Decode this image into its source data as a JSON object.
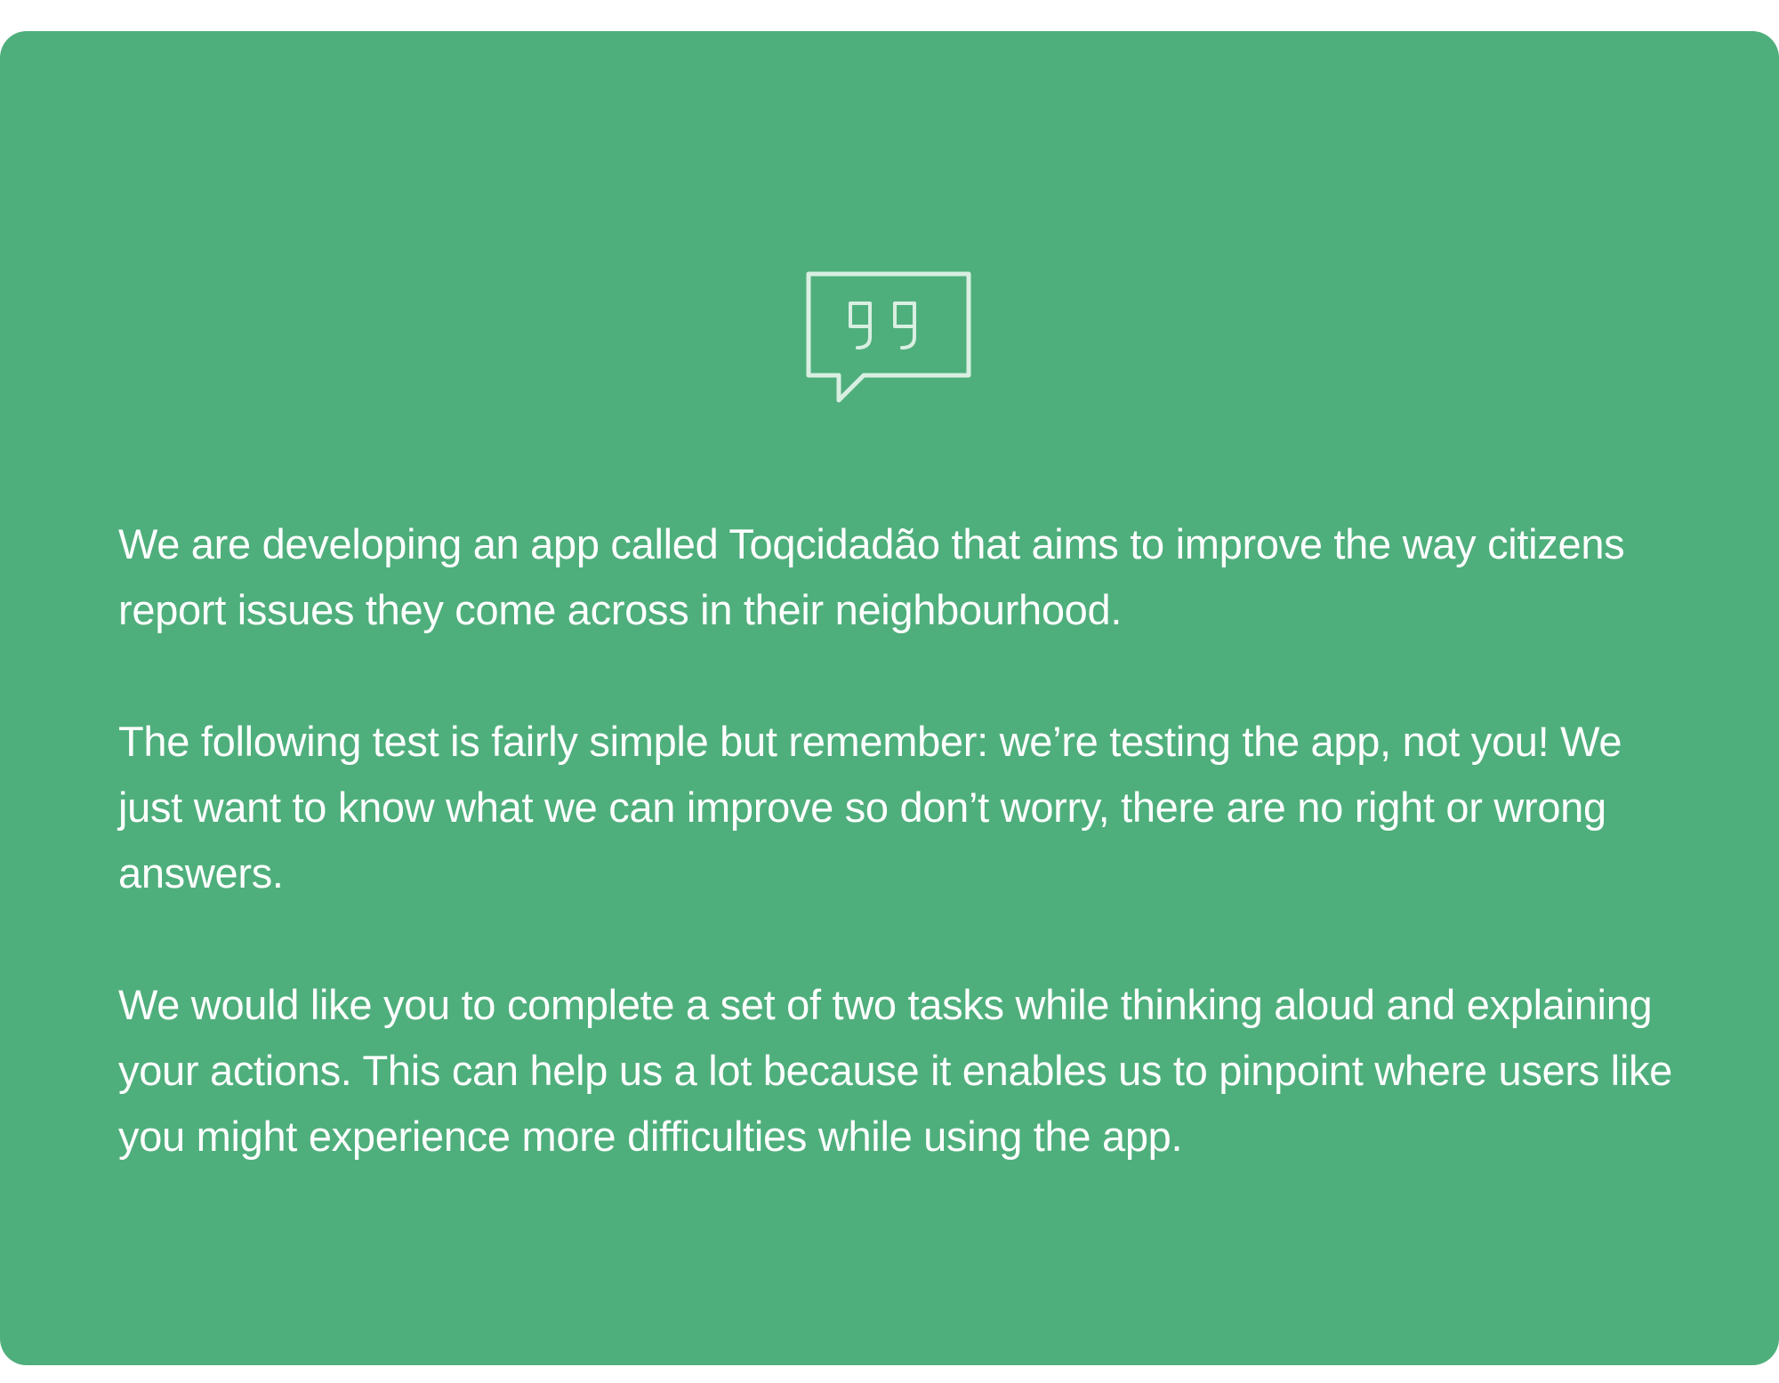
{
  "card": {
    "background_color": "#4faf7c",
    "text_color": "#ffffff",
    "icon": "quote-speech-bubble-icon",
    "paragraphs": [
      "We are developing an app called Toqcidadão that aims to improve the way citizens report issues they come across in their neighbourhood.",
      "The following test is fairly simple but remember: we’re testing the app, not you! We just want to know what we can improve so don’t worry, there are no right or wrong answers.",
      "We would like you to complete a set of two tasks while thinking aloud and explaining your actions. This can help us a lot because it enables us to pinpoint where users like you might experience more difficulties while using the app."
    ]
  }
}
